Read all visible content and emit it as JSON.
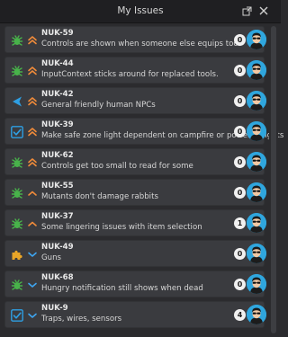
{
  "window": {
    "title": "My Issues",
    "popout_icon": "popout-icon",
    "close_icon": "close-icon"
  },
  "colors": {
    "bug": "#48b24a",
    "story": "#2e9fe3",
    "task": "#2e9fe3",
    "epic": "#e8a528",
    "priority_high": "#f08b3a",
    "priority_medium": "#f08b3a",
    "priority_low": "#3ea5f0",
    "avatar_bg": "#2fa6de"
  },
  "issues": [
    {
      "key": "NUK-59",
      "summary": "Controls are shown when someone else equips tool",
      "type": "bug",
      "priority": "high",
      "comments": "0"
    },
    {
      "key": "NUK-44",
      "summary": "InputContext sticks around for replaced tools.",
      "type": "bug",
      "priority": "high",
      "comments": "0"
    },
    {
      "key": "NUK-42",
      "summary": "General friendly human NPCs",
      "type": "story",
      "priority": "high",
      "comments": "0"
    },
    {
      "key": "NUK-39",
      "summary": "Make safe zone light dependent on campfire or powered lights",
      "type": "task",
      "priority": "high",
      "comments": "0"
    },
    {
      "key": "NUK-62",
      "summary": "Controls get too small to read for some",
      "type": "bug",
      "priority": "high",
      "comments": "0"
    },
    {
      "key": "NUK-55",
      "summary": "Mutants don't damage rabbits",
      "type": "bug",
      "priority": "medium",
      "comments": "0"
    },
    {
      "key": "NUK-37",
      "summary": "Some lingering issues with item selection",
      "type": "bug",
      "priority": "medium",
      "comments": "1"
    },
    {
      "key": "NUK-49",
      "summary": "Guns",
      "type": "epic",
      "priority": "low",
      "comments": "0"
    },
    {
      "key": "NUK-68",
      "summary": "Hungry notification still shows when dead",
      "type": "bug",
      "priority": "low",
      "comments": "0"
    },
    {
      "key": "NUK-9",
      "summary": "Traps, wires, sensors",
      "type": "task",
      "priority": "low",
      "comments": "4"
    }
  ]
}
